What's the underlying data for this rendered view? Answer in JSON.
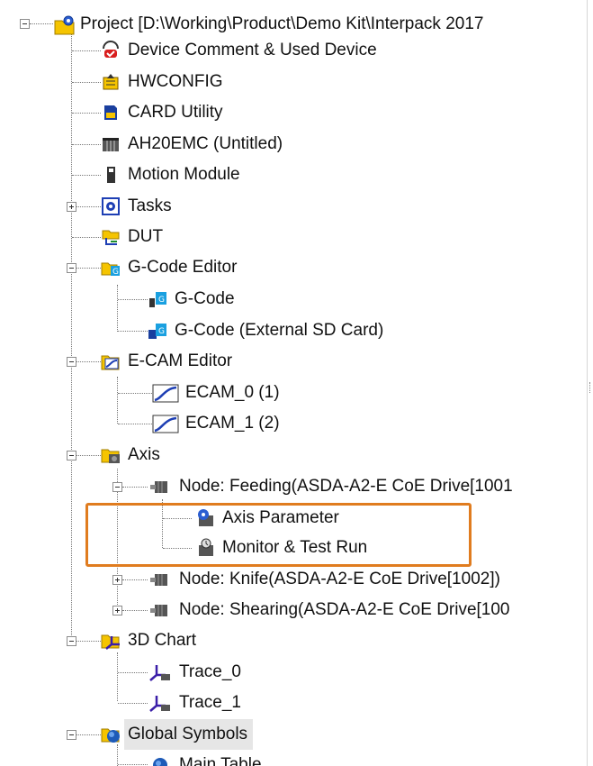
{
  "tree": {
    "root": "Project [D:\\Working\\Product\\Demo Kit\\Interpack 2017",
    "device_comment": "Device Comment & Used Device",
    "hwconfig": "HWCONFIG",
    "card_utility": "CARD Utility",
    "ah20emc": "AH20EMC  (Untitled)",
    "motion_module": "Motion Module",
    "tasks": "Tasks",
    "dut": "DUT",
    "gcode_editor": "G-Code Editor",
    "gcode": "G-Code",
    "gcode_sd": "G-Code (External SD Card)",
    "ecam_editor": "E-CAM Editor",
    "ecam0": "ECAM_0 (1)",
    "ecam1": "ECAM_1 (2)",
    "axis": "Axis",
    "node_feeding": "Node: Feeding(ASDA-A2-E CoE Drive[1001",
    "axis_parameter": "Axis Parameter",
    "monitor_test_run": "Monitor & Test Run",
    "node_knife": "Node: Knife(ASDA-A2-E CoE Drive[1002])",
    "node_shearing": "Node: Shearing(ASDA-A2-E CoE Drive[100",
    "chart3d": "3D Chart",
    "trace0": "Trace_0",
    "trace1": "Trace_1",
    "global_symbols": "Global Symbols",
    "main_table": "Main Table"
  },
  "colors": {
    "highlight_border": "#e07c1f",
    "selected_bg": "#e6e6e6",
    "folder_yellow": "#f5c400",
    "icon_blue": "#1e3fb4"
  }
}
